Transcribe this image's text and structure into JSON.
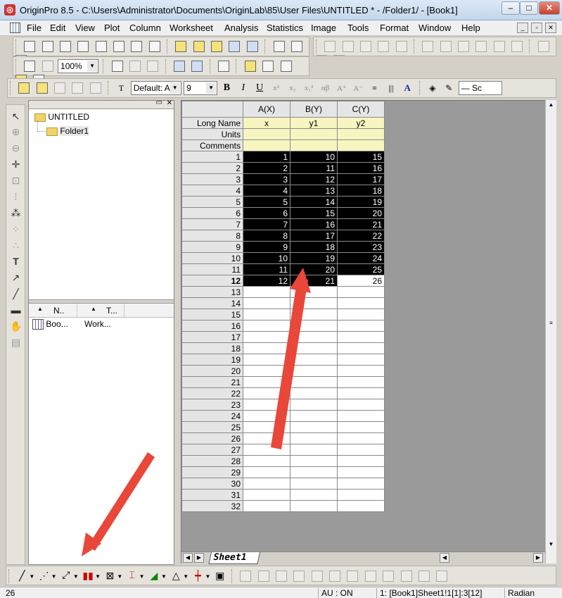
{
  "window": {
    "title": "OriginPro 8.5 - C:\\Users\\Administrator\\Documents\\OriginLab\\85\\User Files\\UNTITLED * - /Folder1/ - [Book1]",
    "minimize": "–",
    "maximize": "□",
    "close": "✕"
  },
  "menu": [
    "File",
    "Edit",
    "View",
    "Plot",
    "Column",
    "Worksheet",
    "Analysis",
    "Statistics",
    "Image",
    "Tools",
    "Format",
    "Window",
    "Help"
  ],
  "mdi_buttons": [
    "_",
    "▫",
    "✕"
  ],
  "toolbar": {
    "zoom": "100%",
    "font": "Default: A",
    "font_size": "9",
    "bold": "B",
    "italic": "I",
    "underline": "U",
    "line_style": "Sc"
  },
  "explorer": {
    "root": "UNTITLED",
    "folder": "Folder1",
    "col_name": "N..",
    "col_type": "T...",
    "item_name": "Boo...",
    "item_type": "Work..."
  },
  "worksheet": {
    "col_headers": [
      "A(X)",
      "B(Y)",
      "C(Y)"
    ],
    "row_labels": [
      "Long Name",
      "Units",
      "Comments"
    ],
    "long_names": [
      "x",
      "y1",
      "y2"
    ],
    "rows": 32,
    "col_a": [
      1,
      2,
      3,
      4,
      5,
      6,
      7,
      8,
      9,
      10,
      11,
      12
    ],
    "col_b": [
      10,
      11,
      12,
      13,
      14,
      15,
      16,
      17,
      18,
      19,
      20,
      21
    ],
    "col_c": [
      15,
      16,
      17,
      18,
      19,
      20,
      21,
      22,
      23,
      24,
      25,
      26
    ],
    "sheet_tab": "Sheet1"
  },
  "status": {
    "left": "26",
    "au": "AU : ON",
    "ref": "1: [Book1]Sheet1!1[1]:3[12]",
    "angle": "Radian"
  },
  "accent": {
    "arrow": "#e8473a",
    "selection": "#000000",
    "label_bg": "#f7f5c0"
  }
}
